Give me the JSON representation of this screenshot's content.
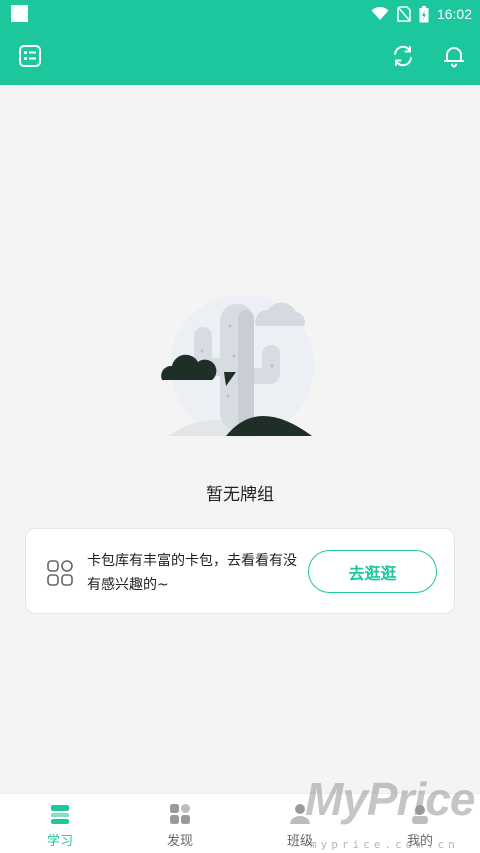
{
  "status_bar": {
    "time": "16:02",
    "icons": [
      "notification-square-icon",
      "wifi-icon",
      "no-sim-icon",
      "battery-icon"
    ]
  },
  "app_bar": {
    "left_icon": "card-list-icon",
    "right_icons": [
      "refresh-icon",
      "bell-icon"
    ]
  },
  "empty_state": {
    "title": "暂无牌组",
    "illustration": "cactus-icon"
  },
  "promo_card": {
    "text": "卡包库有丰富的卡包，去看看有没有感兴趣的~",
    "button_label": "去逛逛",
    "icon": "grid-apps-icon"
  },
  "tabs": [
    {
      "label": "学习",
      "icon": "study-icon",
      "active": true
    },
    {
      "label": "发现",
      "icon": "discover-icon",
      "active": false
    },
    {
      "label": "班级",
      "icon": "class-icon",
      "active": false
    },
    {
      "label": "我的",
      "icon": "profile-icon",
      "active": false
    }
  ],
  "watermark": {
    "brand": "MyPrice",
    "url": "myprice.com.cn"
  },
  "colors": {
    "accent": "#1cc79d",
    "background": "#f4f4f4",
    "tab_inactive": "#999999",
    "illustration_dark": "#1f2f28"
  }
}
